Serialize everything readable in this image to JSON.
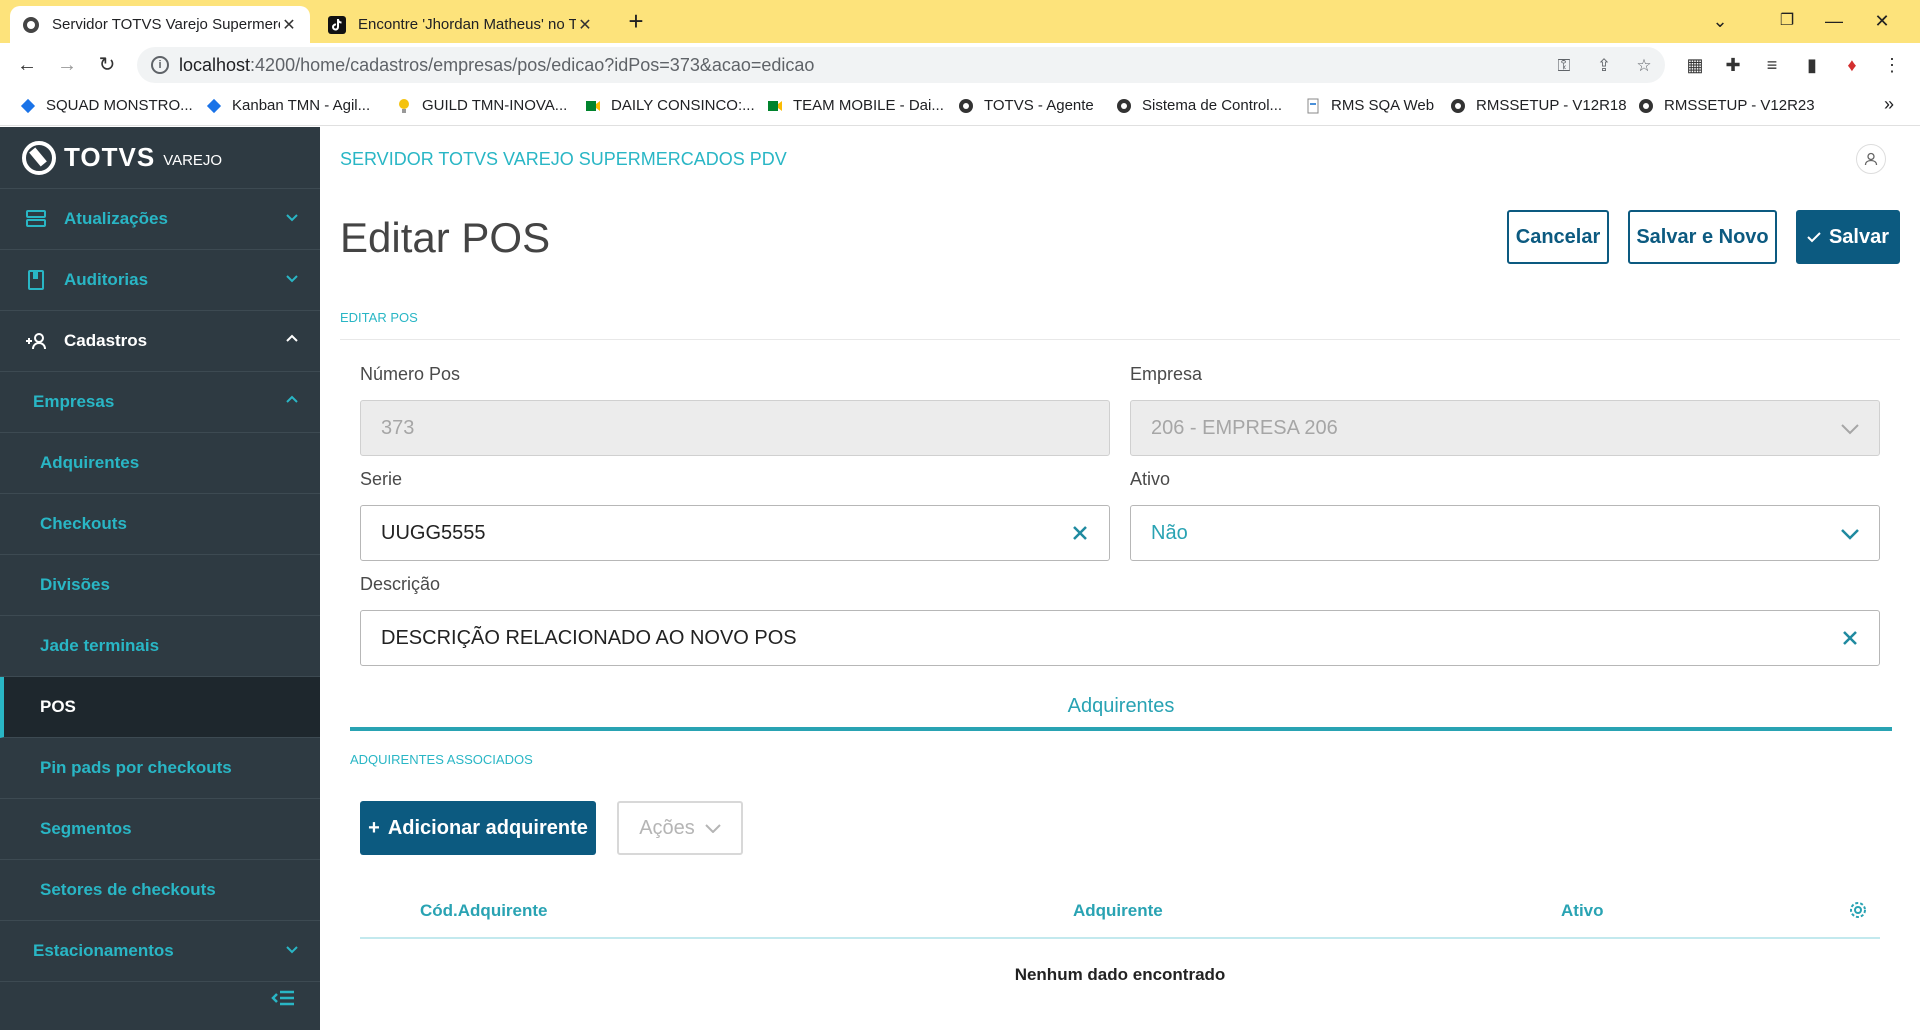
{
  "browser": {
    "tabs": [
      {
        "title": "Servidor TOTVS Varejo Supermercados PDV",
        "active": true
      },
      {
        "title": "Encontre 'Jhordan Matheus' no TikTok",
        "active": false
      }
    ],
    "url_host": "localhost",
    "url_rest": ":4200/home/cadastros/empresas/pos/edicao?idPos=373&acao=edicao",
    "bookmarks": [
      {
        "label": "SQUAD MONSTRO...",
        "icon": "diamond-blue-icon",
        "color": "#1a73e8"
      },
      {
        "label": "Kanban TMN - Agil...",
        "icon": "diamond-blue-icon",
        "color": "#1a73e8"
      },
      {
        "label": "GUILD TMN-INOVA...",
        "icon": "lightbulb-icon",
        "color": "#f4c20d"
      },
      {
        "label": "DAILY CONSINCO:...",
        "icon": "meet-icon",
        "color": "#00832d"
      },
      {
        "label": "TEAM MOBILE - Dai...",
        "icon": "meet-icon",
        "color": "#00832d"
      },
      {
        "label": "TOTVS - Agente",
        "icon": "globe-icon",
        "color": "#333333"
      },
      {
        "label": "Sistema de Control...",
        "icon": "globe-icon",
        "color": "#333333"
      },
      {
        "label": "RMS SQA Web",
        "icon": "page-icon",
        "color": "#888888"
      },
      {
        "label": "RMSSETUP - V12R18",
        "icon": "globe-icon",
        "color": "#333333"
      },
      {
        "label": "RMSSETUP - V12R23",
        "icon": "globe-icon",
        "color": "#333333"
      }
    ],
    "more_bookmarks": "»"
  },
  "sidebar": {
    "brand": "TOTVS",
    "brand_sub": "VAREJO",
    "items": [
      {
        "label": "Atualizações",
        "icon": "monitor-icon"
      },
      {
        "label": "Auditorias",
        "icon": "book-icon"
      },
      {
        "label": "Cadastros",
        "icon": "add-user-icon"
      },
      {
        "label": "Empresas"
      },
      {
        "label": "Adquirentes"
      },
      {
        "label": "Checkouts"
      },
      {
        "label": "Divisões"
      },
      {
        "label": "Jade terminais"
      },
      {
        "label": "POS"
      },
      {
        "label": "Pin pads por checkouts"
      },
      {
        "label": "Segmentos"
      },
      {
        "label": "Setores de checkouts"
      },
      {
        "label": "Estacionamentos"
      }
    ]
  },
  "main": {
    "app_title": "SERVIDOR TOTVS VAREJO SUPERMERCADOS PDV",
    "page_title": "Editar POS",
    "buttons": {
      "cancel": "Cancelar",
      "save_new": "Salvar e Novo",
      "save": "Salvar"
    },
    "section_label": "EDITAR POS",
    "fields": {
      "numero_pos_label": "Número Pos",
      "numero_pos_value": "373",
      "empresa_label": "Empresa",
      "empresa_value": "206 - EMPRESA 206",
      "serie_label": "Serie",
      "serie_value": "UUGG5555",
      "ativo_label": "Ativo",
      "ativo_value": "Não",
      "descricao_label": "Descrição",
      "descricao_value": "DESCRIÇÃO RELACIONADO AO NOVO POS"
    },
    "tab_label": "Adquirentes",
    "assoc_label": "ADQUIRENTES ASSOCIADOS",
    "add_button": "Adicionar adquirente",
    "add_prefix": "+",
    "actions_button": "Ações",
    "table": {
      "columns": [
        "Cód.Adquirente",
        "Adquirente",
        "Ativo"
      ],
      "empty_message": "Nenhum dado encontrado"
    }
  },
  "colors": {
    "accent": "#29b6c5",
    "primary": "#0c5a80",
    "sidebar_bg": "#2e3a42",
    "tabbar_bg": "#fde37b"
  }
}
